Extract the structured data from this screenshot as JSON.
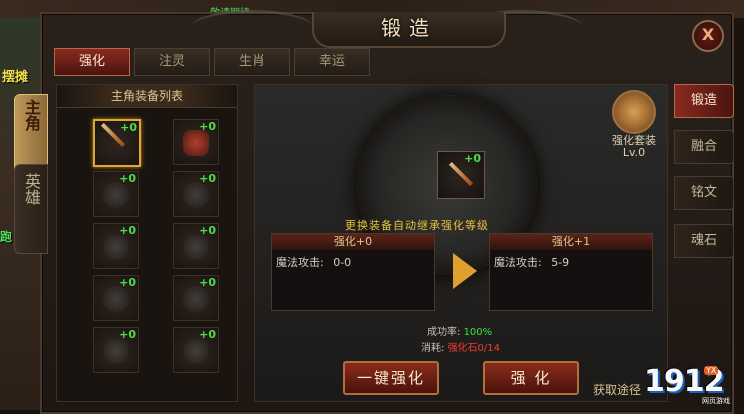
{
  "window": {
    "title": "锻造",
    "close_label": "X"
  },
  "world": {
    "notice": "敬请期待",
    "banner": "摆摊",
    "banner2": "跑"
  },
  "top_tabs": [
    {
      "label": "强化",
      "active": true
    },
    {
      "label": "注灵",
      "active": false
    },
    {
      "label": "生肖",
      "active": false
    },
    {
      "label": "幸运",
      "active": false
    }
  ],
  "side_tabs": {
    "main": "主角",
    "hero": "英雄"
  },
  "equip_panel": {
    "title": "主角装备列表",
    "slots": [
      {
        "name": "weapon",
        "plus": "+0"
      },
      {
        "name": "armor",
        "plus": "+0"
      },
      {
        "name": "helmet",
        "plus": "+0"
      },
      {
        "name": "necklace",
        "plus": "+0"
      },
      {
        "name": "bracelet-left",
        "plus": "+0"
      },
      {
        "name": "bracelet-right",
        "plus": "+0"
      },
      {
        "name": "ring-left",
        "plus": "+0"
      },
      {
        "name": "ring-right",
        "plus": "+0"
      },
      {
        "name": "belt",
        "plus": "+0"
      },
      {
        "name": "boots",
        "plus": "+0"
      }
    ]
  },
  "forge": {
    "center_plus": "+0",
    "notice": "更换装备自动继承强化等级",
    "current": {
      "head": "强化+0",
      "stat_label": "魔法攻击:",
      "stat_value": "0-0"
    },
    "next": {
      "head": "强化+1",
      "stat_label": "魔法攻击:",
      "stat_value": "5-9"
    },
    "success_label": "成功率:",
    "success_value": "100%",
    "cost_label": "消耗:",
    "cost_value": "强化石0/14",
    "one_click_label": "一键强化",
    "enhance_label": "强 化",
    "obtain_label": "获取途径"
  },
  "set": {
    "label": "强化套装",
    "level": "Lv.0"
  },
  "right_tabs": [
    {
      "label": "锻造",
      "active": true
    },
    {
      "label": "融合",
      "active": false
    },
    {
      "label": "铭文",
      "active": false
    },
    {
      "label": "魂石",
      "active": false
    }
  ],
  "watermark": {
    "brand": "1912",
    "badge": "YX",
    "sub": "网页游戏"
  }
}
